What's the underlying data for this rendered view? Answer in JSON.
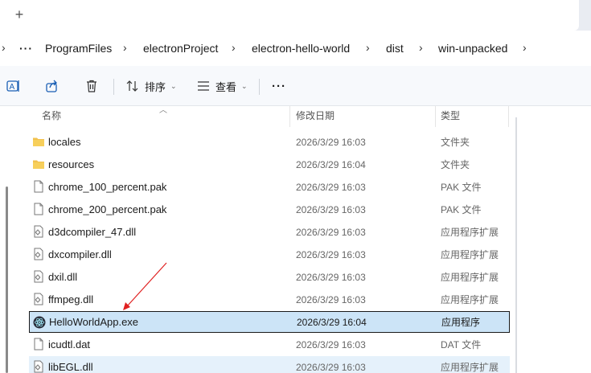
{
  "tabstrip": {
    "new_tab_icon": "plus-icon"
  },
  "address": {
    "more_label": "···",
    "crumbs": [
      "ProgramFiles",
      "electronProject",
      "electron-hello-world",
      "dist",
      "win-unpacked"
    ]
  },
  "toolbar": {
    "sort_label": "排序",
    "view_label": "查看",
    "more_label": "···"
  },
  "columns": {
    "name": "名称",
    "date": "修改日期",
    "type": "类型"
  },
  "files": [
    {
      "name": "locales",
      "date": "2026/3/29 16:03",
      "type": "文件夹",
      "icon": "folder-icon"
    },
    {
      "name": "resources",
      "date": "2026/3/29 16:04",
      "type": "文件夹",
      "icon": "folder-icon"
    },
    {
      "name": "chrome_100_percent.pak",
      "date": "2026/3/29 16:03",
      "type": "PAK 文件",
      "icon": "file-icon"
    },
    {
      "name": "chrome_200_percent.pak",
      "date": "2026/3/29 16:03",
      "type": "PAK 文件",
      "icon": "file-icon"
    },
    {
      "name": "d3dcompiler_47.dll",
      "date": "2026/3/29 16:03",
      "type": "应用程序扩展",
      "icon": "dll-icon"
    },
    {
      "name": "dxcompiler.dll",
      "date": "2026/3/29 16:03",
      "type": "应用程序扩展",
      "icon": "dll-icon"
    },
    {
      "name": "dxil.dll",
      "date": "2026/3/29 16:03",
      "type": "应用程序扩展",
      "icon": "dll-icon"
    },
    {
      "name": "ffmpeg.dll",
      "date": "2026/3/29 16:03",
      "type": "应用程序扩展",
      "icon": "dll-icon"
    },
    {
      "name": "HelloWorldApp.exe",
      "date": "2026/3/29 16:04",
      "type": "应用程序",
      "icon": "electron-app-icon"
    },
    {
      "name": "icudtl.dat",
      "date": "2026/3/29 16:03",
      "type": "DAT 文件",
      "icon": "file-icon"
    },
    {
      "name": "libEGL.dll",
      "date": "2026/3/29 16:03",
      "type": "应用程序扩展",
      "icon": "dll-icon"
    }
  ],
  "selected_file": "HelloWorldApp.exe",
  "colors": {
    "selection": "#cce4f7",
    "folder": "#f2c14e",
    "annotation_arrow": "#e02020"
  }
}
